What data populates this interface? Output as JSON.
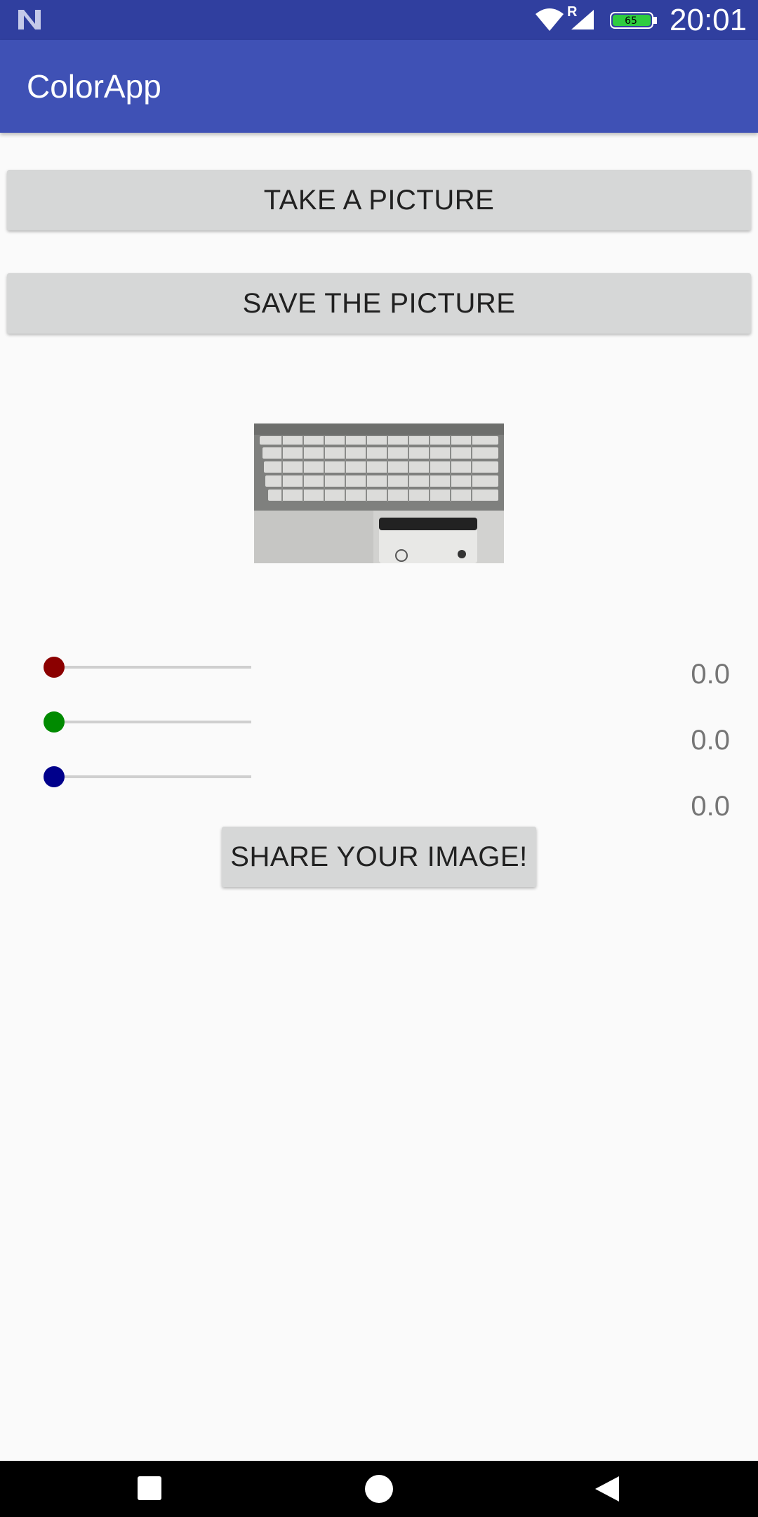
{
  "status_bar": {
    "time": "20:01",
    "battery": "65",
    "network_badge": "R",
    "icons": [
      "notification-n-icon",
      "wifi-icon",
      "cell-signal-icon",
      "battery-icon"
    ]
  },
  "app_bar": {
    "title": "ColorApp"
  },
  "buttons": {
    "take_picture": "TAKE A PICTURE",
    "save_picture": "SAVE THE PICTURE",
    "share_image": "SHARE YOUR IMAGE!"
  },
  "sliders": [
    {
      "name": "red",
      "value": 0.0,
      "value_label": "0.0",
      "color": "#8b0000"
    },
    {
      "name": "green",
      "value": 0.0,
      "value_label": "0.0",
      "color": "#008a00"
    },
    {
      "name": "blue",
      "value": 0.0,
      "value_label": "0.0",
      "color": "#00008b"
    }
  ],
  "photo": {
    "subject": "laptop-keyboard-photo"
  },
  "nav_bar": {
    "icons": [
      "recents-square-icon",
      "home-circle-icon",
      "back-triangle-icon"
    ]
  },
  "colors": {
    "status_bar": "#303f9f",
    "app_bar": "#3f51b5",
    "button": "#d6d7d7",
    "background": "#fafafa"
  }
}
